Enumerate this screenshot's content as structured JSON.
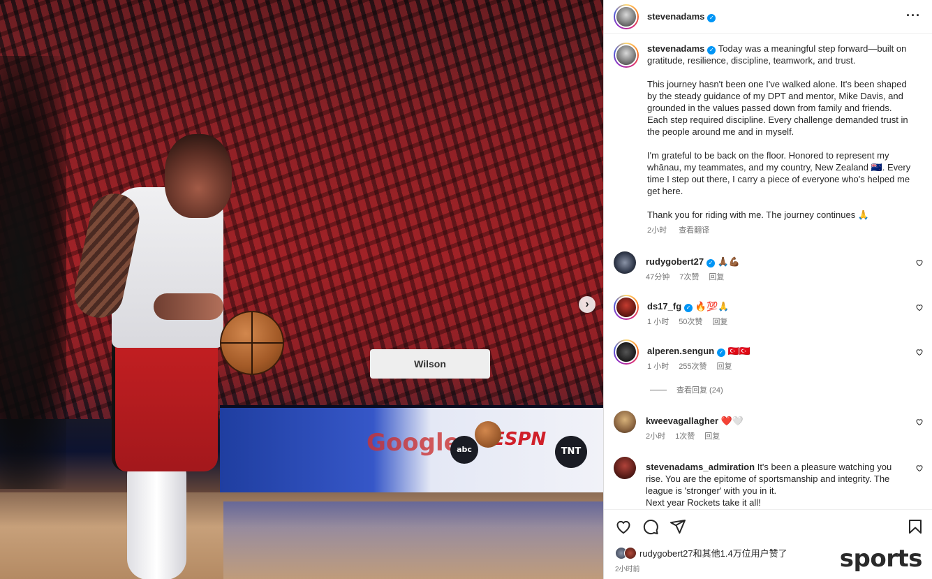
{
  "header": {
    "username": "stevenadams",
    "more_label": "···"
  },
  "caption": {
    "username": "stevenadams",
    "paragraphs": [
      "Today was a meaningful step forward—built on gratitude, resilience, discipline, teamwork, and trust.",
      "This journey hasn't been one I've walked alone. It's been shaped by the steady guidance of my DPT and mentor, Mike Davis, and grounded in the values passed down from family and friends. Each step required discipline. Every challenge demanded trust in the people around me and in myself.",
      "I'm grateful to be back on the floor. Honored to represent my whānau, my teammates, and my country, New Zealand 🇳🇿. Every time I step out there, I carry a piece of everyone who's helped me get here.",
      "Thank you for riding with me. The journey continues 🙏"
    ],
    "time": "2小时",
    "translate_label": "查看翻译"
  },
  "comments": [
    {
      "username": "rudygobert27",
      "verified": true,
      "text": "🙏🏾💪🏾",
      "time": "47分钟",
      "likes": "7次赞",
      "reply": "回复"
    },
    {
      "username": "ds17_fg",
      "verified": true,
      "text": "🔥💯🙏",
      "time": "1 小时",
      "likes": "50次赞",
      "reply": "回复"
    },
    {
      "username": "alperen.sengun",
      "verified": true,
      "text": "🇹🇷🇹🇷",
      "time": "1 小时",
      "likes": "255次赞",
      "reply": "回复",
      "view_replies": "查看回复 (24)"
    },
    {
      "username": "kweevagallagher",
      "verified": false,
      "text": "❤️🤍",
      "time": "2小时",
      "likes": "1次赞",
      "reply": "回复"
    },
    {
      "username": "stevenadams_admiration",
      "verified": false,
      "text": "It's been a pleasure watching you rise. You are the epitome of sportsmanship and integrity. The league is 'stronger' with you in it.\nNext year Rockets take it all!"
    }
  ],
  "footer": {
    "likes_text": "rudygobert27和其他1.4万位用户赞了",
    "post_time": "2小时前",
    "watermark": "sports"
  },
  "photo": {
    "board_words": [
      "Google",
      "ESPN",
      "TNT",
      "abc"
    ],
    "table_sign": "Wilson"
  }
}
